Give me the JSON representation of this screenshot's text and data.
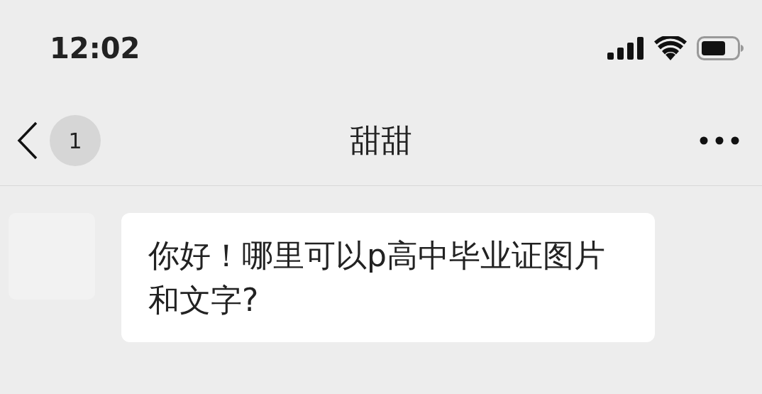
{
  "status_bar": {
    "time": "12:02"
  },
  "nav_bar": {
    "unread_count": "1",
    "title": "甜甜"
  },
  "messages": [
    {
      "kind": "incoming",
      "text": "你好！哪里可以p高中毕业证图片和文字?"
    }
  ]
}
